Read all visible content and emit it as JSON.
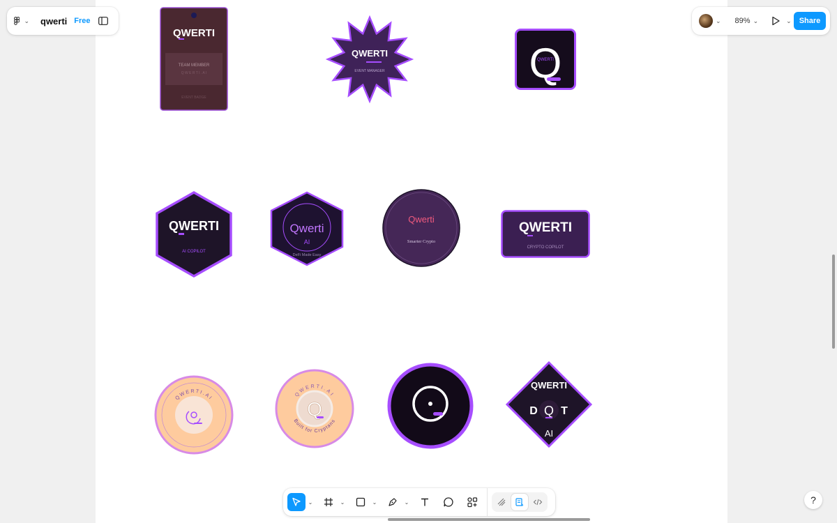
{
  "app": {
    "file_name": "qwerti",
    "plan": "Free",
    "zoom": "89%",
    "share_label": "Share",
    "help_label": "?"
  },
  "toolbar": {
    "tools": [
      "move-tool",
      "frame-tool",
      "rectangle-tool",
      "pen-tool",
      "text-tool",
      "comment-tool",
      "actions-tool"
    ],
    "modes": [
      "draw-mode",
      "design-mode",
      "dev-mode"
    ],
    "active_tool": "move-tool",
    "active_mode": "design-mode"
  },
  "colors": {
    "accent": "#0d99ff",
    "purple": "#a64dff",
    "dark": "#1e1428",
    "peach": "#fecb9e"
  },
  "badges": {
    "event_badge": {
      "brand": "QWERTI",
      "role": "TEAM MEMBER",
      "spaced": "Q W E R T I . A I",
      "footer": "EVENT BADGE"
    },
    "star_badge": {
      "brand": "QWERTI",
      "role": "EVENT MANAGER"
    },
    "square_badge": {
      "letter": "Q",
      "brand": "QWERTI"
    },
    "hex_badge": {
      "brand": "QWERTI",
      "tagline": "AI COPILOT"
    },
    "hex_circle_badge": {
      "brand": "Qwerti",
      "sub": "AI",
      "tagline": "DeFi Made Easy"
    },
    "round_badge": {
      "brand": "Qwerti",
      "tagline": "Smarter Crypto"
    },
    "rect_badge": {
      "brand": "QWERTI",
      "tagline": "CRYPTO COPILOT"
    },
    "peach_badge_1": {
      "ring_text": "QWERTI.AI"
    },
    "peach_badge_2": {
      "ring_top": "QWERTI.AI",
      "ring_bottom": "Built for Cryptans",
      "letter": "Q"
    },
    "ring_badge": {
      "letter": "Q"
    },
    "diamond_badge": {
      "brand": "QWERTI",
      "left": "D",
      "letter": "Q",
      "right": "T",
      "bottom": "AI"
    }
  }
}
